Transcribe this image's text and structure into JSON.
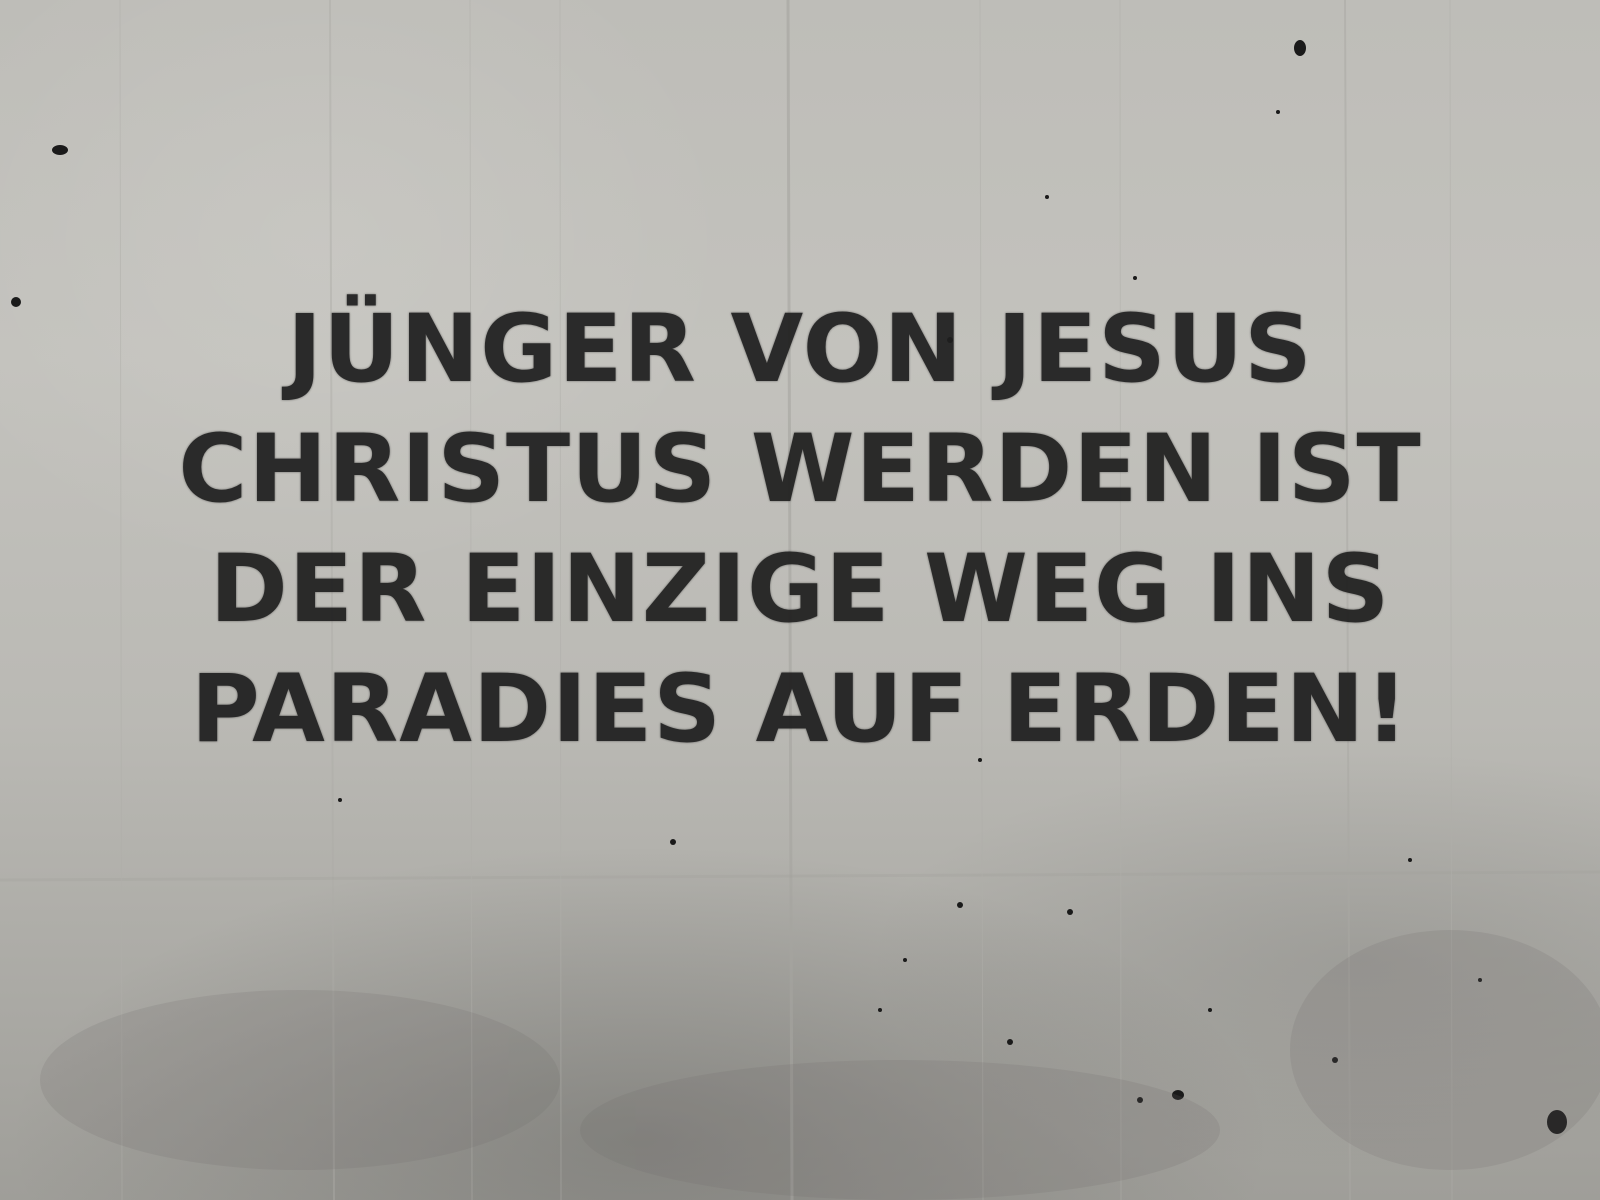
{
  "scene": {
    "surface": "concrete-wall",
    "paint_color": "#1f1f1f",
    "wall_color": "#bebdb8"
  },
  "stencil_text": {
    "lines": [
      "JÜNGER VON JESUS",
      "CHRISTUS WERDEN IST",
      "DER EINZIGE WEG INS",
      "PARADIES AUF ERDEN!"
    ]
  }
}
